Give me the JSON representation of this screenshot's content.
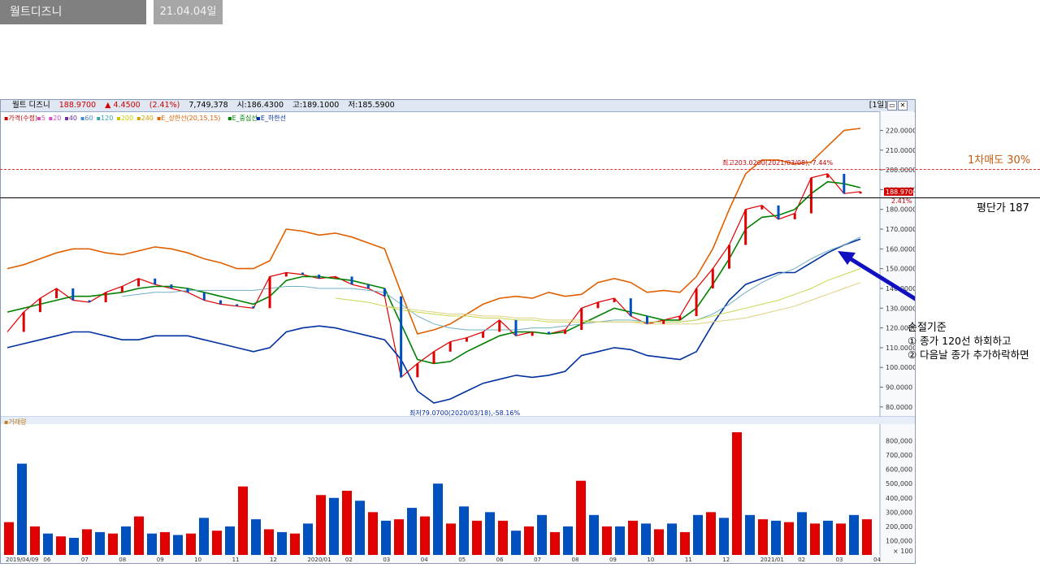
{
  "tabs": {
    "title": "월트디즈니",
    "date": "21.04.04일"
  },
  "header": {
    "name": "월트 디즈니",
    "price": "188.9700",
    "change": "▲ 4.4500",
    "change_pct": "(2.41%)",
    "volume": "7,749,378",
    "open": "시:186.4300",
    "high": "고:189.1000",
    "low": "저:185.5900",
    "period": "[1일]"
  },
  "legend": [
    {
      "label": "▪가격(수정)",
      "color": "#c00000"
    },
    {
      "label": "▪5",
      "color": "#d050c0"
    },
    {
      "label": "▪20",
      "color": "#d050c0"
    },
    {
      "label": "▪40",
      "color": "#7030a0"
    },
    {
      "label": "▪60",
      "color": "#4a86c8"
    },
    {
      "label": "▪120",
      "color": "#3aa0b0"
    },
    {
      "label": "▪200",
      "color": "#c8c800"
    },
    {
      "label": "▪240",
      "color": "#d0a000"
    },
    {
      "label": "▪E_상한선(20,15,15)",
      "color": "#e06000"
    },
    {
      "label": "▪E_중심선",
      "color": "#008000"
    },
    {
      "label": "▪E_하한선",
      "color": "#0030a0"
    }
  ],
  "volume_panel": {
    "label": "▪거래량",
    "unit": "× 100"
  },
  "annotations": {
    "sell_label": "1차매도 30%",
    "avg_label": "평단가 187",
    "stop_title": "손절기준",
    "stop_rule1": "① 종가 120선 하회하고",
    "stop_rule2": "② 다음날 종가 추가하락하면",
    "high_marker": "최고203.0200(2021/03/08),-7.44%",
    "low_marker": "최저79.0700(2020/03/18),-58.16%",
    "price_badge": "188.9700",
    "pct_badge": "2.41%"
  },
  "colors": {
    "up": "#e00000",
    "down": "#0050c0",
    "upper_band": "#e06000",
    "mid_band": "#008000",
    "lower_band": "#0030a0",
    "ma120": "#70b0c0",
    "ma200": "#c8d850",
    "ma240": "#e0d080",
    "arrow": "#1010c0"
  },
  "chart_data": {
    "type": "line",
    "title": "월트 디즈니",
    "y_axis_ticks": [
      "80.0000",
      "90.0000",
      "100.0000",
      "110.0000",
      "120.0000",
      "130.0000",
      "140.0000",
      "150.0000",
      "160.0000",
      "170.0000",
      "180.0000",
      "190.0000",
      "200.0000",
      "210.0000",
      "220.0000"
    ],
    "volume_axis_ticks": [
      "100,000",
      "200,000",
      "300,000",
      "400,000",
      "500,000",
      "600,000",
      "700,000",
      "800,000"
    ],
    "x_axis_ticks": [
      "2019/04/09",
      "06",
      "07",
      "08",
      "09",
      "10",
      "11",
      "12",
      "2020/01",
      "02",
      "03",
      "04",
      "05",
      "06",
      "07",
      "08",
      "09",
      "10",
      "11",
      "12",
      "2021/01",
      "02",
      "03",
      "04"
    ],
    "ylim": [
      75,
      228
    ],
    "volume_ylim": [
      0,
      900000
    ],
    "series": [
      {
        "name": "가격(수정)",
        "key": "price",
        "values": [
          118,
          128,
          135,
          140,
          134,
          133,
          138,
          141,
          145,
          142,
          140,
          138,
          134,
          132,
          131,
          130,
          146,
          148,
          147,
          145,
          146,
          142,
          140,
          136,
          95,
          102,
          108,
          113,
          115,
          118,
          124,
          116,
          118,
          117,
          119,
          130,
          133,
          135,
          126,
          122,
          124,
          126,
          140,
          150,
          162,
          180,
          182,
          175,
          178,
          196,
          198,
          188,
          189
        ]
      },
      {
        "name": "E_중심선",
        "key": "mid",
        "values": [
          128,
          130,
          132,
          134,
          136,
          136,
          137,
          138,
          140,
          141,
          141,
          140,
          138,
          136,
          134,
          132,
          136,
          144,
          146,
          146,
          145,
          144,
          142,
          140,
          122,
          104,
          102,
          103,
          108,
          112,
          116,
          118,
          118,
          117,
          118,
          122,
          126,
          130,
          128,
          126,
          124,
          124,
          130,
          142,
          155,
          170,
          176,
          177,
          180,
          188,
          194,
          193,
          191
        ]
      },
      {
        "name": "E_상한선",
        "key": "upper",
        "values": [
          150,
          152,
          155,
          158,
          160,
          160,
          158,
          157,
          159,
          161,
          160,
          158,
          155,
          153,
          150,
          150,
          154,
          170,
          169,
          167,
          168,
          166,
          163,
          160,
          138,
          117,
          119,
          122,
          127,
          132,
          135,
          136,
          135,
          138,
          136,
          137,
          143,
          145,
          143,
          138,
          139,
          138,
          146,
          160,
          180,
          198,
          205,
          205,
          203,
          204,
          212,
          220,
          221
        ]
      },
      {
        "name": "E_하한선",
        "key": "lower",
        "values": [
          110,
          112,
          114,
          116,
          118,
          118,
          116,
          114,
          114,
          116,
          116,
          116,
          114,
          112,
          110,
          108,
          110,
          118,
          120,
          121,
          120,
          118,
          116,
          114,
          104,
          88,
          82,
          84,
          88,
          92,
          94,
          96,
          95,
          96,
          98,
          106,
          108,
          110,
          109,
          106,
          105,
          104,
          108,
          122,
          134,
          142,
          145,
          148,
          148,
          153,
          158,
          162,
          165
        ]
      },
      {
        "name": "120",
        "key": "ma120",
        "values": [
          null,
          null,
          null,
          null,
          null,
          null,
          null,
          136,
          137,
          138,
          138,
          139,
          139,
          139,
          139,
          139,
          140,
          141,
          141,
          140,
          140,
          140,
          139,
          138,
          132,
          126,
          122,
          120,
          119,
          119,
          119,
          119,
          120,
          120,
          121,
          122,
          123,
          124,
          124,
          123,
          123,
          123,
          124,
          127,
          132,
          138,
          143,
          147,
          150,
          155,
          159,
          162,
          166
        ]
      },
      {
        "name": "200",
        "key": "ma200",
        "values": [
          null,
          null,
          null,
          null,
          null,
          null,
          null,
          null,
          null,
          null,
          null,
          null,
          null,
          null,
          null,
          null,
          null,
          null,
          null,
          null,
          135,
          134,
          133,
          131,
          129,
          128,
          127,
          126,
          126,
          125,
          125,
          124,
          124,
          123,
          123,
          123,
          123,
          123,
          123,
          123,
          123,
          123,
          124,
          126,
          128,
          130,
          132,
          134,
          137,
          140,
          144,
          147,
          150
        ]
      },
      {
        "name": "240",
        "key": "ma240",
        "values": [
          null,
          null,
          null,
          null,
          null,
          null,
          null,
          null,
          null,
          null,
          null,
          null,
          null,
          null,
          null,
          null,
          null,
          null,
          null,
          null,
          null,
          null,
          null,
          131,
          130,
          129,
          128,
          127,
          127,
          126,
          126,
          125,
          125,
          124,
          124,
          124,
          123,
          123,
          123,
          122,
          122,
          122,
          122,
          123,
          124,
          125,
          127,
          129,
          131,
          134,
          137,
          140,
          143
        ]
      }
    ],
    "volume": [
      230,
      640,
      200,
      150,
      130,
      120,
      180,
      160,
      150,
      200,
      270,
      150,
      160,
      140,
      150,
      260,
      170,
      200,
      480,
      250,
      180,
      160,
      150,
      220,
      420,
      400,
      450,
      380,
      300,
      240,
      250,
      330,
      270,
      500,
      220,
      340,
      240,
      300,
      240,
      170,
      200,
      280,
      160,
      200,
      520,
      280,
      200,
      200,
      240,
      220,
      180,
      220,
      160,
      280,
      300,
      260,
      860,
      280,
      250,
      240,
      230,
      300,
      220,
      240,
      220,
      280,
      250
    ]
  }
}
